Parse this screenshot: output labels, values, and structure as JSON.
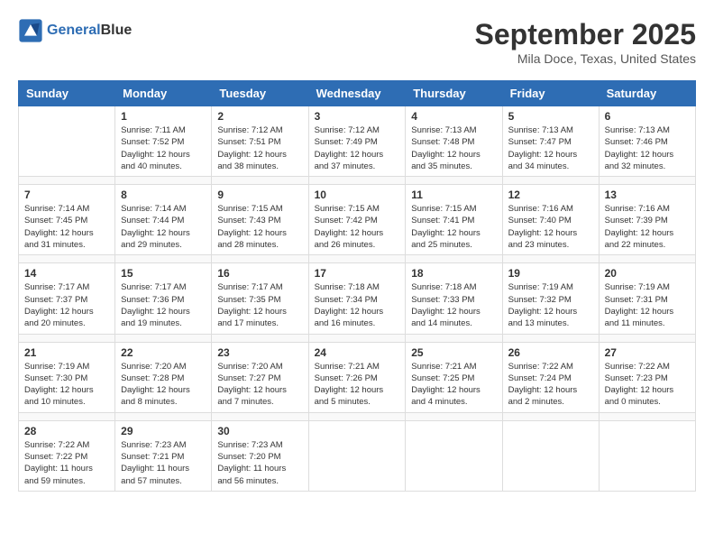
{
  "header": {
    "logo_line1": "General",
    "logo_line2": "Blue",
    "title": "September 2025",
    "location": "Mila Doce, Texas, United States"
  },
  "weekdays": [
    "Sunday",
    "Monday",
    "Tuesday",
    "Wednesday",
    "Thursday",
    "Friday",
    "Saturday"
  ],
  "weeks": [
    {
      "days": [
        {
          "num": "",
          "info": ""
        },
        {
          "num": "1",
          "info": "Sunrise: 7:11 AM\nSunset: 7:52 PM\nDaylight: 12 hours\nand 40 minutes."
        },
        {
          "num": "2",
          "info": "Sunrise: 7:12 AM\nSunset: 7:51 PM\nDaylight: 12 hours\nand 38 minutes."
        },
        {
          "num": "3",
          "info": "Sunrise: 7:12 AM\nSunset: 7:49 PM\nDaylight: 12 hours\nand 37 minutes."
        },
        {
          "num": "4",
          "info": "Sunrise: 7:13 AM\nSunset: 7:48 PM\nDaylight: 12 hours\nand 35 minutes."
        },
        {
          "num": "5",
          "info": "Sunrise: 7:13 AM\nSunset: 7:47 PM\nDaylight: 12 hours\nand 34 minutes."
        },
        {
          "num": "6",
          "info": "Sunrise: 7:13 AM\nSunset: 7:46 PM\nDaylight: 12 hours\nand 32 minutes."
        }
      ]
    },
    {
      "days": [
        {
          "num": "7",
          "info": "Sunrise: 7:14 AM\nSunset: 7:45 PM\nDaylight: 12 hours\nand 31 minutes."
        },
        {
          "num": "8",
          "info": "Sunrise: 7:14 AM\nSunset: 7:44 PM\nDaylight: 12 hours\nand 29 minutes."
        },
        {
          "num": "9",
          "info": "Sunrise: 7:15 AM\nSunset: 7:43 PM\nDaylight: 12 hours\nand 28 minutes."
        },
        {
          "num": "10",
          "info": "Sunrise: 7:15 AM\nSunset: 7:42 PM\nDaylight: 12 hours\nand 26 minutes."
        },
        {
          "num": "11",
          "info": "Sunrise: 7:15 AM\nSunset: 7:41 PM\nDaylight: 12 hours\nand 25 minutes."
        },
        {
          "num": "12",
          "info": "Sunrise: 7:16 AM\nSunset: 7:40 PM\nDaylight: 12 hours\nand 23 minutes."
        },
        {
          "num": "13",
          "info": "Sunrise: 7:16 AM\nSunset: 7:39 PM\nDaylight: 12 hours\nand 22 minutes."
        }
      ]
    },
    {
      "days": [
        {
          "num": "14",
          "info": "Sunrise: 7:17 AM\nSunset: 7:37 PM\nDaylight: 12 hours\nand 20 minutes."
        },
        {
          "num": "15",
          "info": "Sunrise: 7:17 AM\nSunset: 7:36 PM\nDaylight: 12 hours\nand 19 minutes."
        },
        {
          "num": "16",
          "info": "Sunrise: 7:17 AM\nSunset: 7:35 PM\nDaylight: 12 hours\nand 17 minutes."
        },
        {
          "num": "17",
          "info": "Sunrise: 7:18 AM\nSunset: 7:34 PM\nDaylight: 12 hours\nand 16 minutes."
        },
        {
          "num": "18",
          "info": "Sunrise: 7:18 AM\nSunset: 7:33 PM\nDaylight: 12 hours\nand 14 minutes."
        },
        {
          "num": "19",
          "info": "Sunrise: 7:19 AM\nSunset: 7:32 PM\nDaylight: 12 hours\nand 13 minutes."
        },
        {
          "num": "20",
          "info": "Sunrise: 7:19 AM\nSunset: 7:31 PM\nDaylight: 12 hours\nand 11 minutes."
        }
      ]
    },
    {
      "days": [
        {
          "num": "21",
          "info": "Sunrise: 7:19 AM\nSunset: 7:30 PM\nDaylight: 12 hours\nand 10 minutes."
        },
        {
          "num": "22",
          "info": "Sunrise: 7:20 AM\nSunset: 7:28 PM\nDaylight: 12 hours\nand 8 minutes."
        },
        {
          "num": "23",
          "info": "Sunrise: 7:20 AM\nSunset: 7:27 PM\nDaylight: 12 hours\nand 7 minutes."
        },
        {
          "num": "24",
          "info": "Sunrise: 7:21 AM\nSunset: 7:26 PM\nDaylight: 12 hours\nand 5 minutes."
        },
        {
          "num": "25",
          "info": "Sunrise: 7:21 AM\nSunset: 7:25 PM\nDaylight: 12 hours\nand 4 minutes."
        },
        {
          "num": "26",
          "info": "Sunrise: 7:22 AM\nSunset: 7:24 PM\nDaylight: 12 hours\nand 2 minutes."
        },
        {
          "num": "27",
          "info": "Sunrise: 7:22 AM\nSunset: 7:23 PM\nDaylight: 12 hours\nand 0 minutes."
        }
      ]
    },
    {
      "days": [
        {
          "num": "28",
          "info": "Sunrise: 7:22 AM\nSunset: 7:22 PM\nDaylight: 11 hours\nand 59 minutes."
        },
        {
          "num": "29",
          "info": "Sunrise: 7:23 AM\nSunset: 7:21 PM\nDaylight: 11 hours\nand 57 minutes."
        },
        {
          "num": "30",
          "info": "Sunrise: 7:23 AM\nSunset: 7:20 PM\nDaylight: 11 hours\nand 56 minutes."
        },
        {
          "num": "",
          "info": ""
        },
        {
          "num": "",
          "info": ""
        },
        {
          "num": "",
          "info": ""
        },
        {
          "num": "",
          "info": ""
        }
      ]
    }
  ]
}
